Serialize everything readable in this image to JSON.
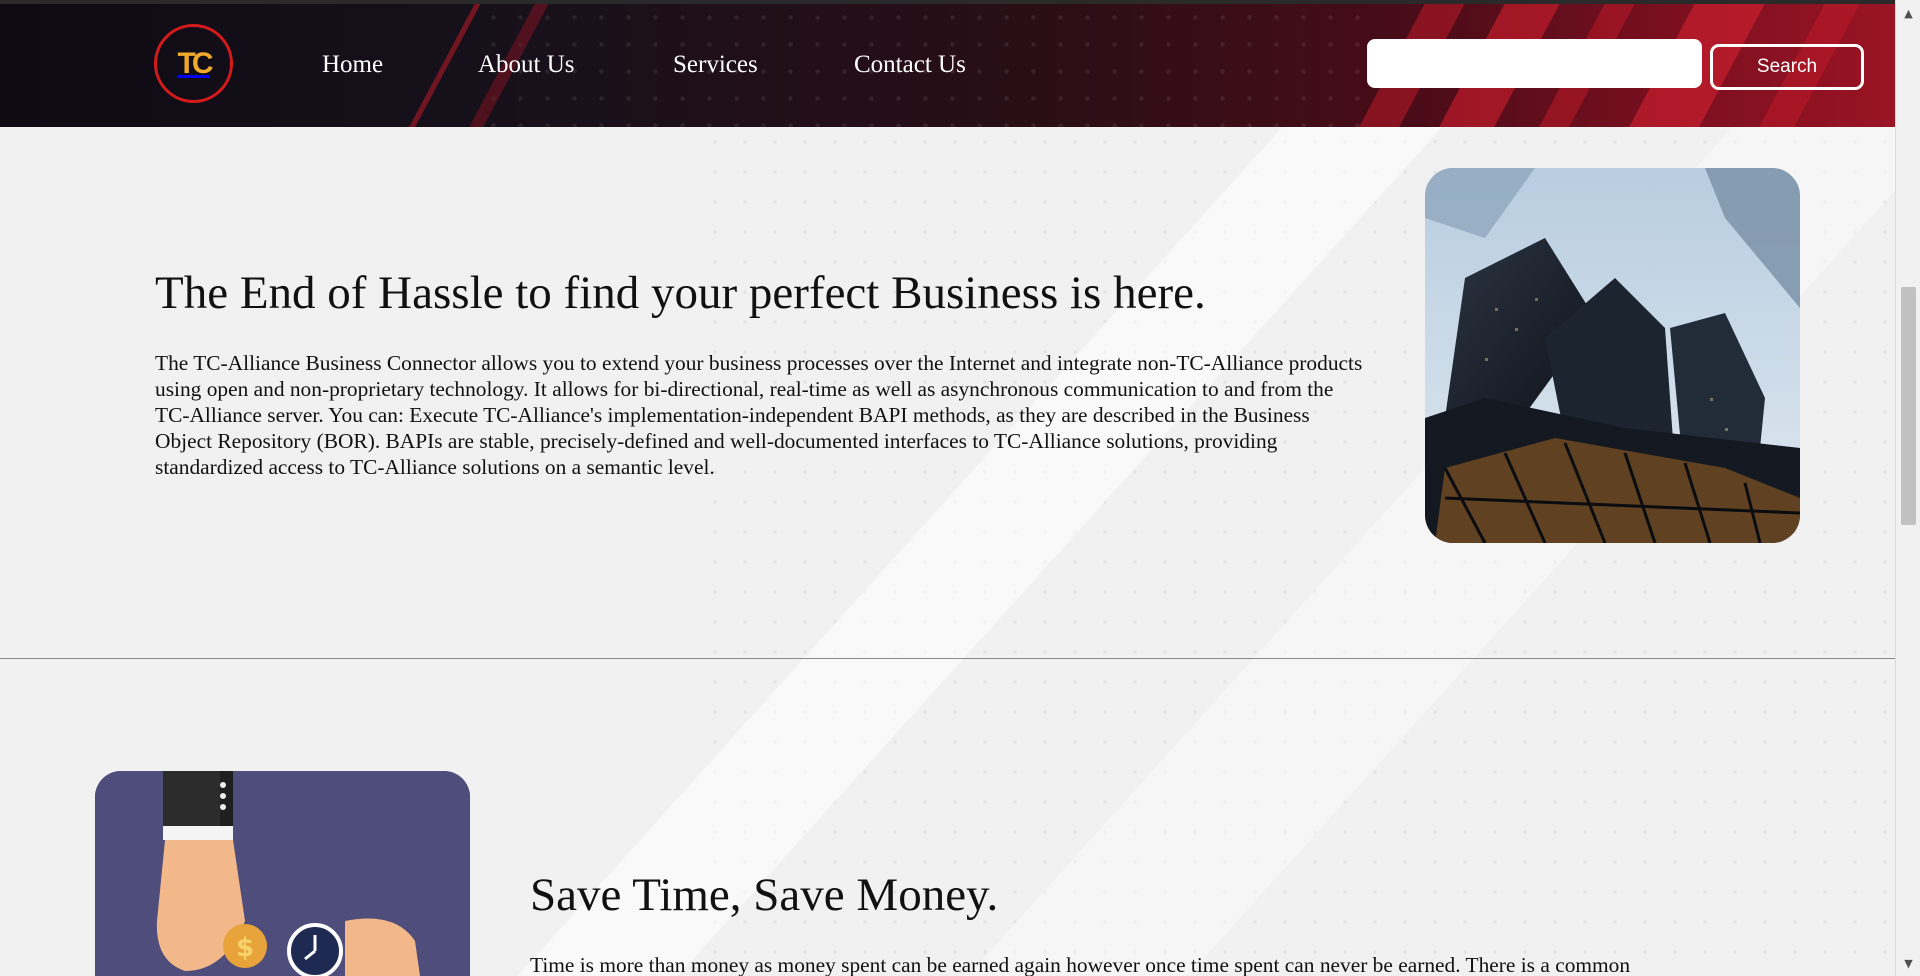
{
  "nav": {
    "logo_text": "TC",
    "links": [
      "Home",
      "About Us",
      "Services",
      "Contact Us"
    ],
    "search": {
      "placeholder": "",
      "button_label": "Search"
    }
  },
  "hero": {
    "title": "The End of Hassle to find your perfect Business is here.",
    "text": "The TC-Alliance Business Connector allows you to extend your business processes over the Internet and integrate non-TC-Alliance products using open and non-proprietary technology. It allows for bi-directional, real-time as well as asynchronous communication to and from the TC-Alliance server. You can: Execute TC-Alliance's implementation-independent BAPI methods, as they are described in the Business Object Repository (BOR). BAPIs are stable, precisely-defined and well-documented interfaces to TC-Alliance solutions, providing standardized access to TC-Alliance solutions on a semantic level."
  },
  "section2": {
    "title": "Save Time, Save Money.",
    "text": "Time is more than money as money spent can be earned again however once time spent can never be earned. There is a common"
  },
  "colors": {
    "accent": "#d41a1a",
    "logo_letters": "#f0a92b",
    "nav_dark": "#0e0b14",
    "nav_red": "#9a1424",
    "card_bg": "#4f4d7b"
  },
  "icons": {
    "hero_image": "skyscrapers-photo",
    "card_image": "hand-coin-clock-illustration",
    "scroll_up": "scroll-up-arrow-icon",
    "scroll_down": "scroll-down-arrow-icon"
  }
}
